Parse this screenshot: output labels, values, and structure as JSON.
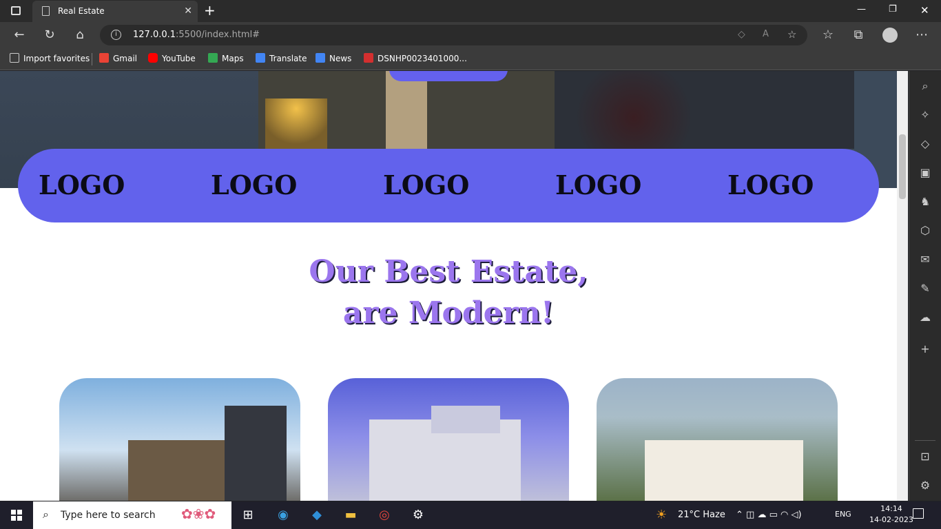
{
  "browser": {
    "tab_title": "Real Estate",
    "url_host": "127.0.0.1",
    "url_rest": ":5500/index.html#",
    "favorites": [
      {
        "label": "Import favorites",
        "color": "#dddddd"
      },
      {
        "label": "Gmail",
        "color": "#ea4335"
      },
      {
        "label": "YouTube",
        "color": "#ff0000"
      },
      {
        "label": "Maps",
        "color": "#34a853"
      },
      {
        "label": "Translate",
        "color": "#4285f4"
      },
      {
        "label": "News",
        "color": "#4285f4"
      },
      {
        "label": "DSNHP0023401000...",
        "color": "#d32f2f"
      }
    ]
  },
  "page": {
    "logos": [
      "LOGO",
      "LOGO",
      "LOGO",
      "LOGO",
      "LOGO"
    ],
    "heading_line1": "Our Best Estate,",
    "heading_line2": "are Modern!",
    "accent_color": "#6262ec",
    "heading_color": "#9b76ee"
  },
  "taskbar": {
    "search_placeholder": "Type here to search",
    "weather": "21°C  Haze",
    "language": "ENG",
    "time": "14:14",
    "date": "14-02-2023"
  }
}
